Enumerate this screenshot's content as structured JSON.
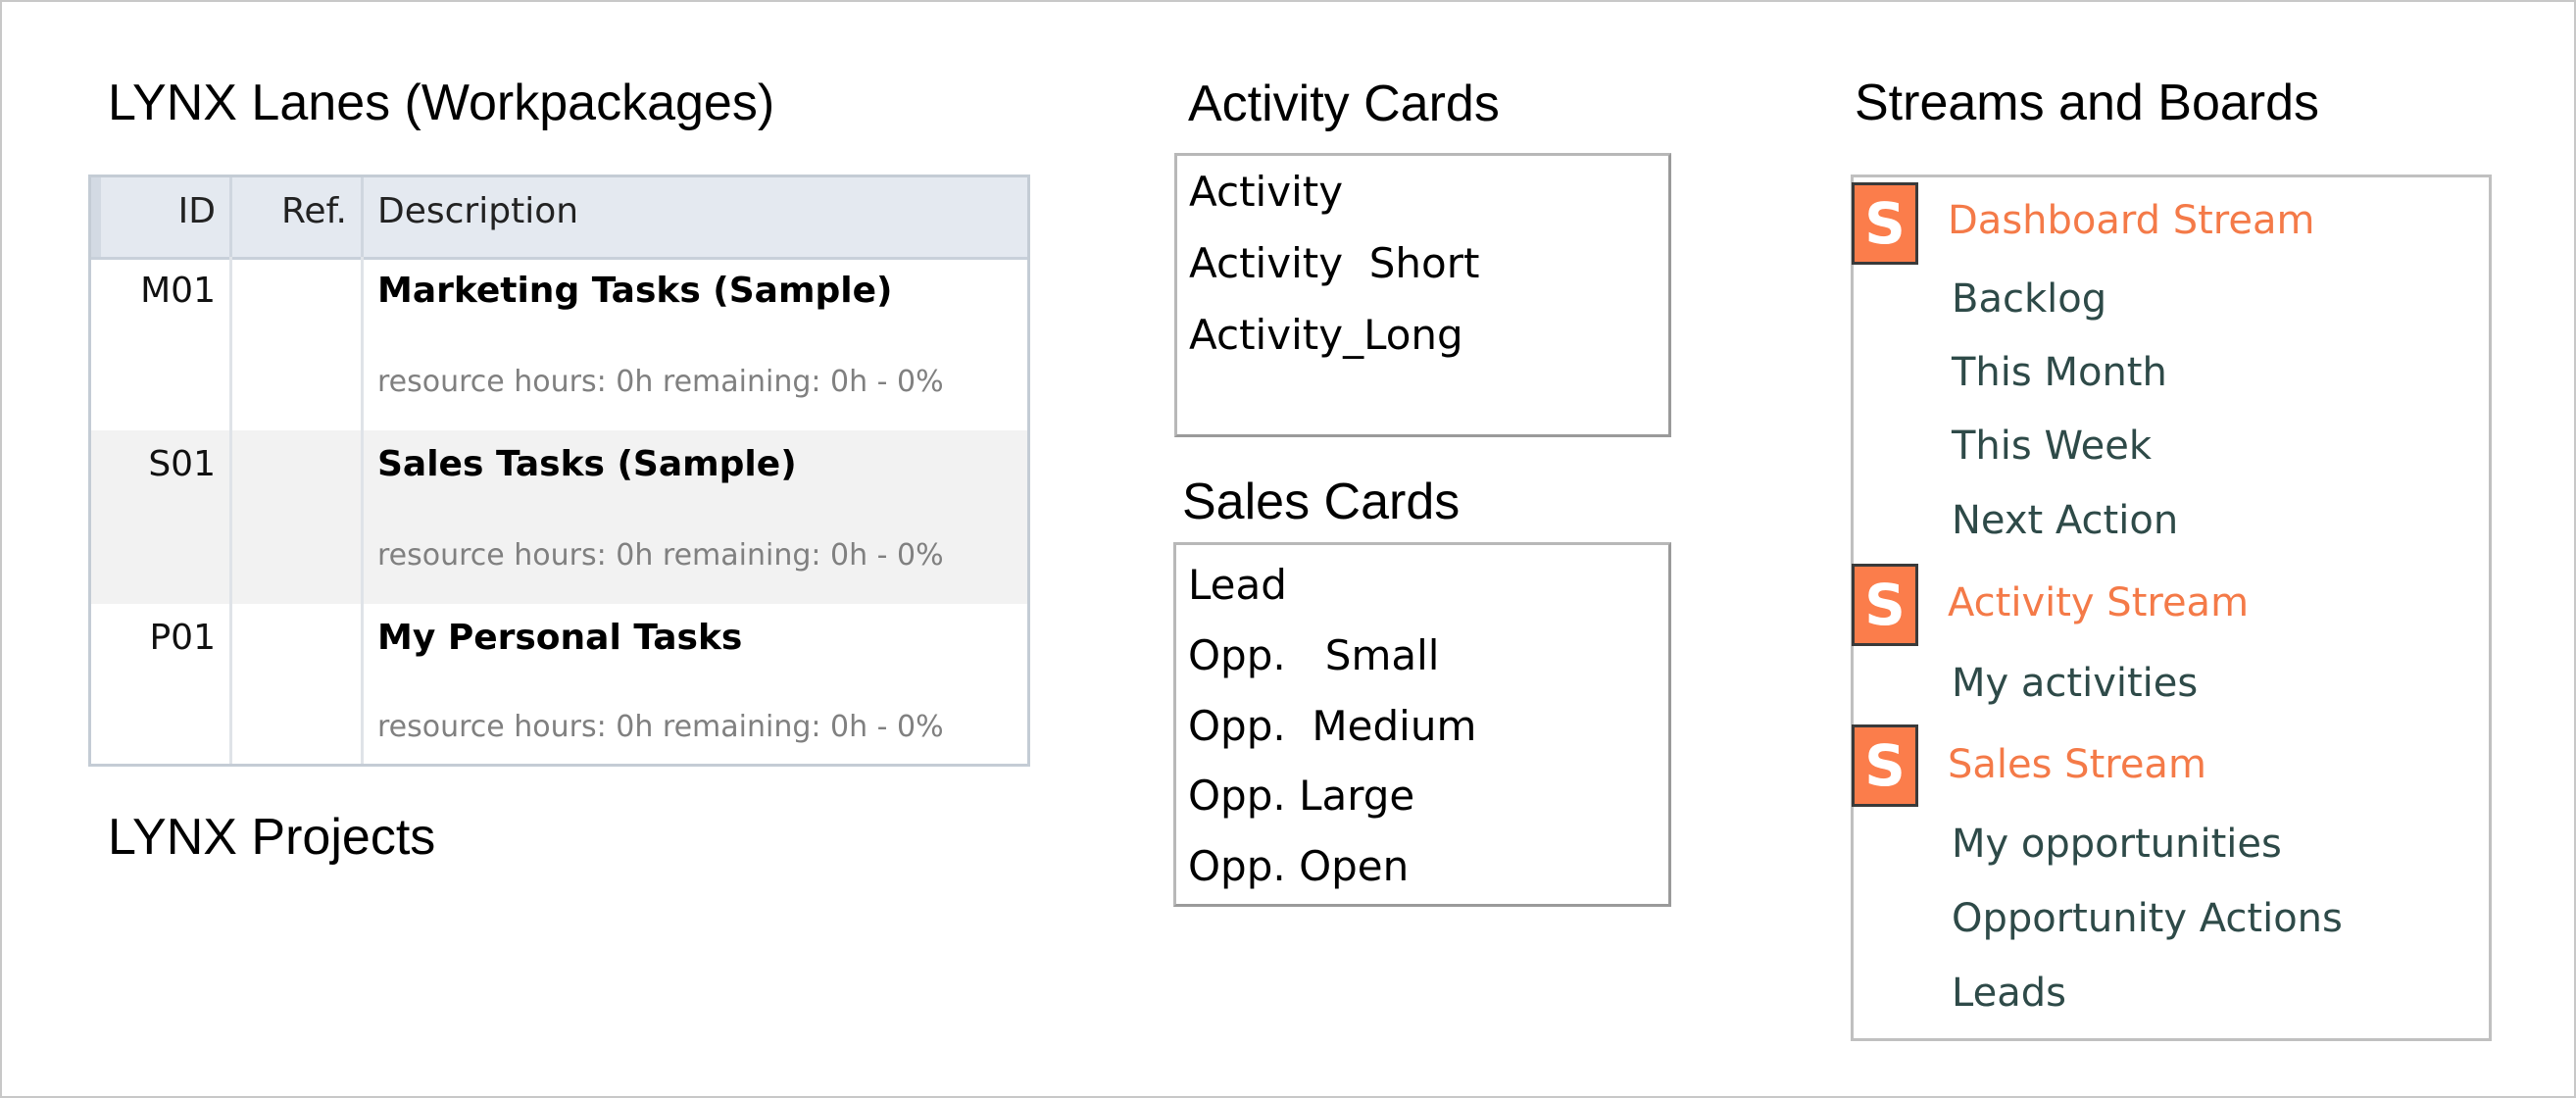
{
  "headings": {
    "lanes": "LYNX Lanes (Workpackages)",
    "projects": "LYNX Projects",
    "activity_cards": "Activity Cards",
    "sales_cards": "Sales Cards",
    "streams": "Streams and Boards"
  },
  "lanes_table": {
    "columns": [
      "ID",
      "Ref.",
      "Description"
    ],
    "rows": [
      {
        "id": "M01",
        "ref": "",
        "title": "Marketing Tasks (Sample)",
        "meta": "resource hours: 0h remaining: 0h - 0%"
      },
      {
        "id": "S01",
        "ref": "",
        "title": "Sales Tasks (Sample)",
        "meta": "resource hours: 0h remaining: 0h - 0%"
      },
      {
        "id": "P01",
        "ref": "",
        "title": "My Personal Tasks",
        "meta": "resource hours: 0h remaining: 0h - 0%"
      }
    ]
  },
  "activity_cards": [
    "Activity",
    "Activity  Short",
    "Activity_Long"
  ],
  "sales_cards": [
    "Lead",
    "Opp.   Small",
    "Opp.  Medium",
    "Opp. Large",
    "Opp. Open"
  ],
  "streams": [
    {
      "icon_letter": "S",
      "icon_color": "#fb7d4b",
      "name": "Dashboard Stream",
      "boards": [
        "Backlog",
        "This Month",
        "This Week",
        "Next Action"
      ]
    },
    {
      "icon_letter": "S",
      "icon_color": "#fb7d4b",
      "name": "Activity Stream",
      "boards": [
        "My activities"
      ]
    },
    {
      "icon_letter": "S",
      "icon_color": "#fb7d4b",
      "name": "Sales Stream",
      "boards": [
        "My opportunities",
        "Opportunity Actions",
        "Leads"
      ]
    }
  ],
  "colors": {
    "stream_accent": "#f47a48",
    "board_text": "#2e4a48",
    "table_header_bg": "#e4e9f0"
  }
}
